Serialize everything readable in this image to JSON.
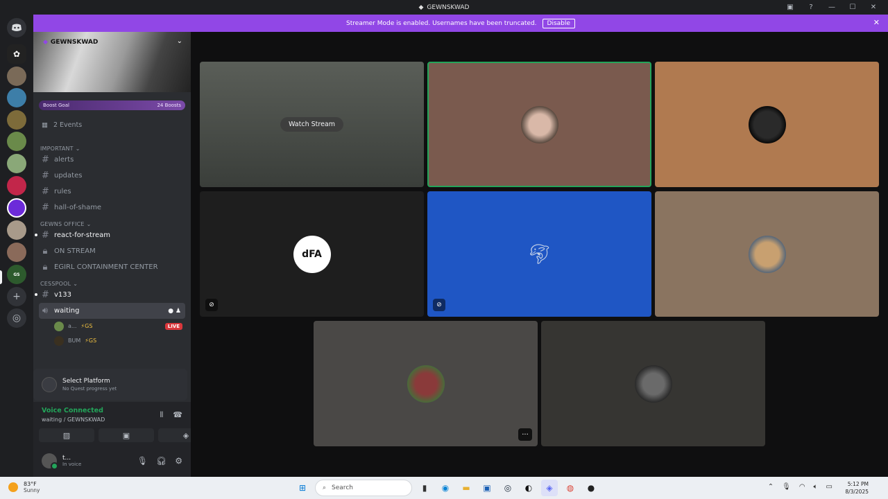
{
  "titlebar": {
    "title": "GEWNSKWAD"
  },
  "banner": {
    "text": "Streamer Mode is enabled. Usernames have been truncated.",
    "button": "Disable"
  },
  "server": {
    "name": "GEWNSKWAD",
    "boost_label": "Boost Goal",
    "boost_count": "24 Boosts"
  },
  "events": {
    "label": "2 Events"
  },
  "categories": [
    {
      "name": "IMPORTANT",
      "channels": [
        "alerts",
        "updates",
        "rules",
        "hall-of-shame"
      ]
    },
    {
      "name": "GEWNS OFFICE",
      "channels": [
        "react-for-stream",
        "ON STREAM",
        "EGIRL CONTAINMENT CENTER"
      ]
    },
    {
      "name": "CESSPOOL",
      "channels": [
        "v133",
        "waiting"
      ]
    }
  ],
  "voice_users": [
    {
      "name": "a...",
      "tag": "⚡GS",
      "live": "LIVE"
    },
    {
      "name": "BUM",
      "tag": "⚡GS"
    }
  ],
  "quest": {
    "title": "Select Platform",
    "subtitle": "No Quest progress yet"
  },
  "voice": {
    "status": "Voice Connected",
    "location": "waiting / GEWNSKWAD"
  },
  "account": {
    "name": "t...",
    "status": "In voice"
  },
  "stage": {
    "watch_label": "Watch Stream"
  },
  "taskbar": {
    "temp": "83°F",
    "condition": "Sunny",
    "search": "Search",
    "time": "5:12 PM",
    "date": "8/3/2025"
  },
  "colors": {
    "accent": "#9147e6",
    "speaking": "#23a55a",
    "live": "#da373c"
  }
}
